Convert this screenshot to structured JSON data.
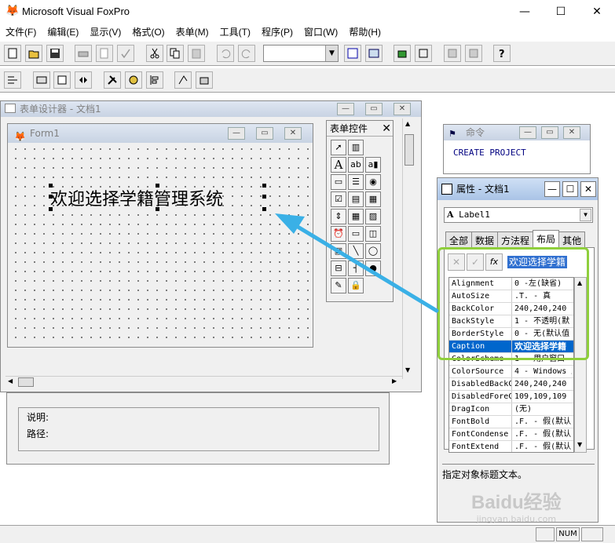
{
  "app": {
    "title": "Microsoft Visual FoxPro",
    "minimize": "—",
    "maximize": "☐",
    "close": "✕"
  },
  "menu": [
    "文件(F)",
    "编辑(E)",
    "显示(V)",
    "格式(O)",
    "表单(M)",
    "工具(T)",
    "程序(P)",
    "窗口(W)",
    "帮助(H)"
  ],
  "toolbar": {
    "combo_value": ""
  },
  "form_designer": {
    "title": "表单设计器 - 文档1"
  },
  "form": {
    "title": "Form1",
    "label_caption": "欢迎选择学籍管理系统"
  },
  "controls_toolbar": {
    "title": "表单控件",
    "close": "✕"
  },
  "command_window": {
    "title": "命令",
    "text": "CREATE PROJECT"
  },
  "properties": {
    "title": "属性 - 文档1",
    "object": "Label1",
    "tabs": [
      "全部",
      "数据",
      "方法程",
      "布局",
      "其他"
    ],
    "active_tab": "布局",
    "edit_value": "欢迎选择学籍",
    "rows": [
      {
        "name": "Alignment",
        "value": "0 -左(缺省)"
      },
      {
        "name": "AutoSize",
        "value": ".T. - 真"
      },
      {
        "name": "BackColor",
        "value": "240,240,240"
      },
      {
        "name": "BackStyle",
        "value": "1 - 不透明(默"
      },
      {
        "name": "BorderStyle",
        "value": "0 - 无(默认值"
      },
      {
        "name": "Caption",
        "value": "欢迎选择学籍"
      },
      {
        "name": "ColorScheme",
        "value": "1 - 用户窗口"
      },
      {
        "name": "ColorSource",
        "value": "4 - Windows 颜"
      },
      {
        "name": "DisabledBackC",
        "value": "240,240,240"
      },
      {
        "name": "DisabledForeC",
        "value": "109,109,109"
      },
      {
        "name": "DragIcon",
        "value": "(无)"
      },
      {
        "name": "FontBold",
        "value": ".F. - 假(默认"
      },
      {
        "name": "FontCondense",
        "value": ".F. - 假(默认"
      },
      {
        "name": "FontExtend",
        "value": ".F. - 假(默认"
      }
    ],
    "description": "指定对象标题文本。"
  },
  "info_panel": {
    "desc_label": "说明:",
    "path_label": "路径:"
  },
  "status": {
    "num": "NUM"
  },
  "watermark": {
    "text": "Baidu经验",
    "url": "jingyan.baidu.com"
  }
}
